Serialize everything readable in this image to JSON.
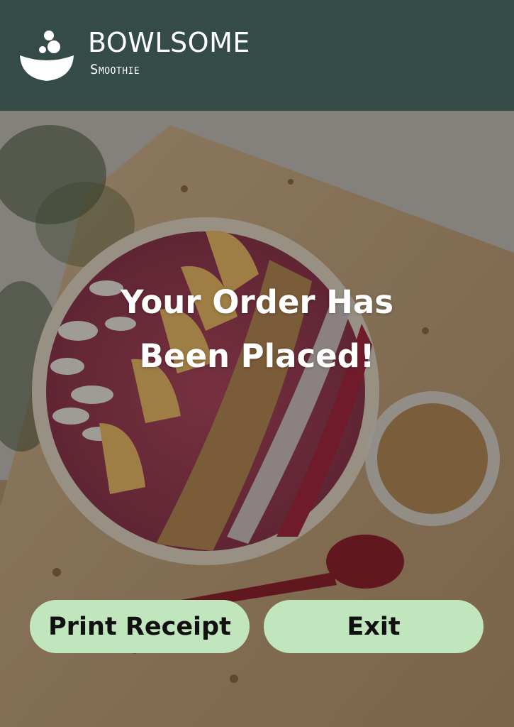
{
  "header": {
    "brand_name": "BOWLSOME",
    "brand_sub": "Smoothie"
  },
  "main": {
    "headline_line1": "Your Order Has",
    "headline_line2": "Been Placed!"
  },
  "actions": {
    "print_label": "Print Receipt",
    "exit_label": "Exit"
  },
  "colors": {
    "header_bg": "#344b48",
    "button_bg": "#c1e6bd",
    "text_light": "#ffffff"
  },
  "icons": {
    "logo": "bowl-logo-icon"
  }
}
